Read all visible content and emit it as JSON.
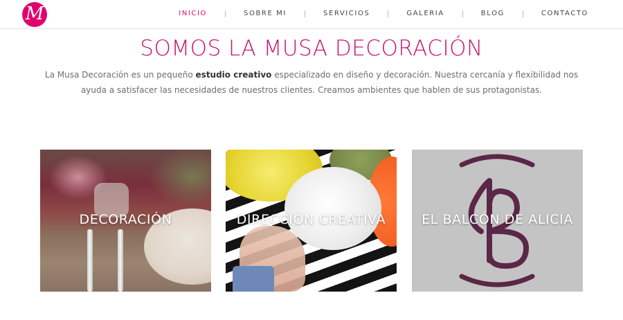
{
  "header": {
    "logo_letter": "M",
    "nav": [
      {
        "label": "INICIO",
        "active": true
      },
      {
        "label": "SOBRE MI",
        "active": false
      },
      {
        "label": "SERVICIOS",
        "active": false
      },
      {
        "label": "GALERIA",
        "active": false
      },
      {
        "label": "BLOG",
        "active": false
      },
      {
        "label": "CONTACTO",
        "active": false
      }
    ]
  },
  "hero": {
    "title": "SOMOS LA MUSA DECORACIÓN",
    "text_before": "La Musa Decoración es un pequeño ",
    "text_bold": "estudio creativo",
    "text_after": " especializado en diseño y decoración. Nuestra cercanía y flexibilidad nos ayuda a satisfacer las necesidades de nuestros clientes. Creamos ambientes que hablen de sus protagonistas."
  },
  "cards": [
    {
      "label": "DECORACIÓN"
    },
    {
      "label": "DIRECCIÓN CREATIVA"
    },
    {
      "label": "EL BALCÓN DE ALICIA"
    }
  ],
  "colors": {
    "brand": "#e0006c",
    "title": "#c8136c",
    "balcon_mark": "#5b2747"
  }
}
